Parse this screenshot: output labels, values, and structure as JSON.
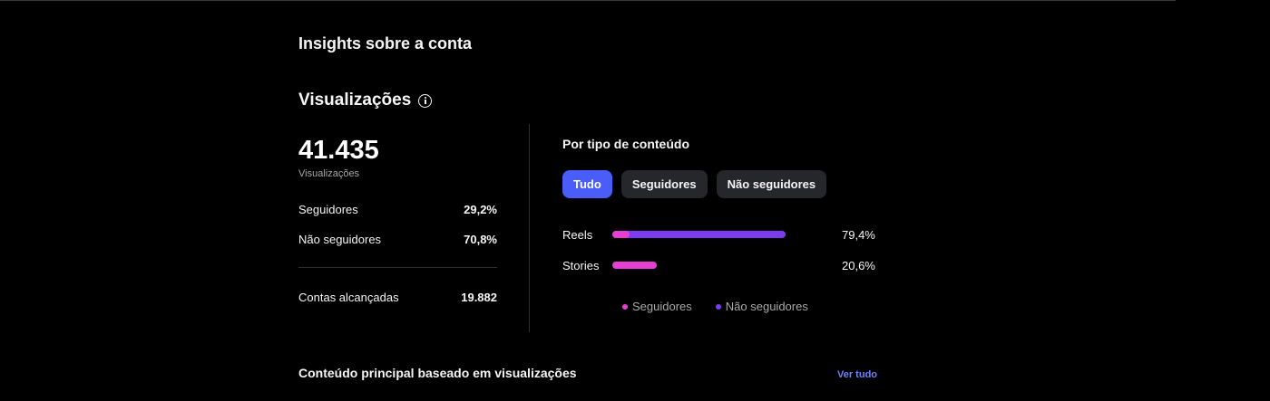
{
  "page": {
    "title": "Insights sobre a conta"
  },
  "views": {
    "section_title": "Visualizações",
    "total": "41.435",
    "total_caption": "Visualizações",
    "stats": [
      {
        "label": "Seguidores",
        "value": "29,2%"
      },
      {
        "label": "Não seguidores",
        "value": "70,8%"
      }
    ],
    "reach": {
      "label": "Contas alcançadas",
      "value": "19.882"
    }
  },
  "by_content": {
    "title": "Por tipo de conteúdo",
    "filters": [
      {
        "label": "Tudo",
        "active": true
      },
      {
        "label": "Seguidores",
        "active": false
      },
      {
        "label": "Não seguidores",
        "active": false
      }
    ],
    "rows": [
      {
        "label": "Reels",
        "percent_label": "79,4%",
        "total_percent": 79.4,
        "followers_fraction": 0.1
      },
      {
        "label": "Stories",
        "percent_label": "20,6%",
        "total_percent": 20.6,
        "followers_fraction": 1.0
      }
    ],
    "legend": [
      {
        "label": "Seguidores",
        "color": "#e53fd3"
      },
      {
        "label": "Não seguidores",
        "color": "#7b3cf0"
      }
    ]
  },
  "top_content": {
    "title": "Conteúdo principal baseado em visualizações",
    "see_all": "Ver tudo"
  },
  "colors": {
    "accent": "#4a5df9",
    "followers": "#e53fd3",
    "non_followers": "#7b3cf0",
    "link": "#6c82ff"
  }
}
